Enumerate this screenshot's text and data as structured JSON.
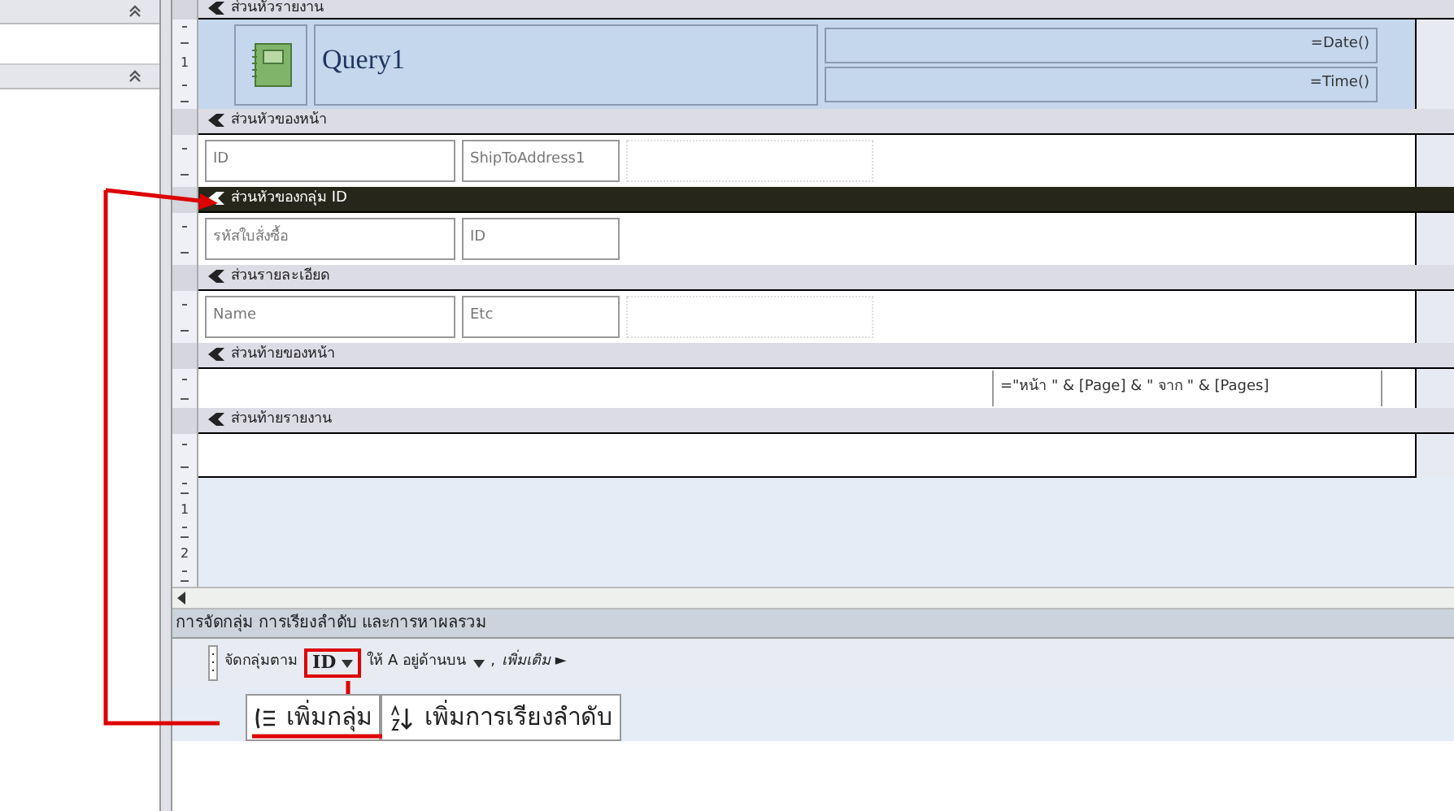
{
  "report_sections": [
    {
      "title": "ส่วนหัวรายงาน",
      "selected": false,
      "kind": "report_header",
      "ruler_labels": [
        "1"
      ],
      "controls": [
        {
          "kind": "logo"
        },
        {
          "kind": "title",
          "text": "Query1"
        },
        {
          "kind": "stack",
          "items": [
            "=Date()",
            "=Time()"
          ]
        }
      ]
    },
    {
      "title": "ส่วนหัวของหน้า",
      "selected": false,
      "kind": "band",
      "controls": [
        {
          "kind": "label",
          "text": "ID"
        },
        {
          "kind": "label",
          "text": "ShipToAddress1"
        },
        {
          "kind": "blank"
        }
      ]
    },
    {
      "title": "ส่วนหัวของกลุ่ม ID",
      "selected": true,
      "kind": "band",
      "controls": [
        {
          "kind": "label",
          "text": "รหัสใบสั่งซื้อ"
        },
        {
          "kind": "label",
          "text": "ID"
        }
      ]
    },
    {
      "title": "ส่วนรายละเอียด",
      "selected": false,
      "kind": "band",
      "controls": [
        {
          "kind": "label",
          "text": "Name"
        },
        {
          "kind": "label",
          "text": "Etc"
        },
        {
          "kind": "blank"
        }
      ]
    },
    {
      "title": "ส่วนท้ายของหน้า",
      "selected": false,
      "kind": "band",
      "controls": [
        {
          "kind": "expression",
          "text": "=\"หน้า \" & [Page] & \" จาก \" & [Pages]"
        }
      ]
    },
    {
      "title": "ส่วนท้ายรายงาน",
      "selected": false,
      "kind": "band"
    }
  ],
  "canvas_ruler_labels": [
    "1",
    "2"
  ],
  "grouping_pane": {
    "title": "การจัดกลุ่ม การเรียงลำดับ และการหาผลรวม",
    "group_row": {
      "prefix": "จัดกลุ่มตาม",
      "field": "ID",
      "order": "ให้ A อยู่ด้านบน",
      "separator": ",",
      "more": "เพิ่มเติม ►"
    },
    "buttons": [
      {
        "kind": "add_group",
        "label": "เพิ่มกลุ่ม"
      },
      {
        "kind": "add_sort",
        "label": "เพิ่มการเรียงลำดับ"
      }
    ]
  }
}
